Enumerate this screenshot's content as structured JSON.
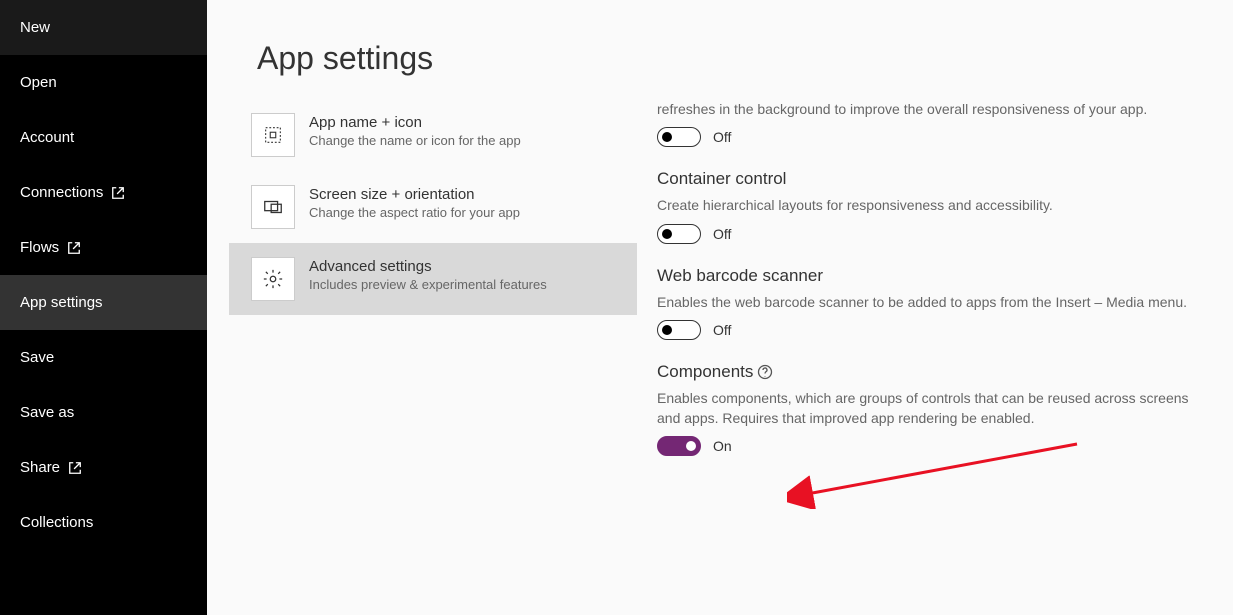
{
  "sidebar": {
    "items": [
      {
        "label": "New",
        "has_ext": false
      },
      {
        "label": "Open",
        "has_ext": false
      },
      {
        "label": "Account",
        "has_ext": false
      },
      {
        "label": "Connections",
        "has_ext": true
      },
      {
        "label": "Flows",
        "has_ext": true
      },
      {
        "label": "App settings",
        "has_ext": false,
        "selected": true
      },
      {
        "label": "Save",
        "has_ext": false
      },
      {
        "label": "Save as",
        "has_ext": false
      },
      {
        "label": "Share",
        "has_ext": true
      },
      {
        "label": "Collections",
        "has_ext": false
      }
    ]
  },
  "page": {
    "title": "App settings"
  },
  "settings_tabs": [
    {
      "icon": "app-icon",
      "title": "App name + icon",
      "desc": "Change the name or icon for the app"
    },
    {
      "icon": "screen-icon",
      "title": "Screen size + orientation",
      "desc": "Change the aspect ratio for your app"
    },
    {
      "icon": "gear-icon",
      "title": "Advanced settings",
      "desc": "Includes preview & experimental features",
      "selected": true
    }
  ],
  "detail": {
    "sections": [
      {
        "truncated_desc": "refreshes in the background to improve the overall responsiveness of your app.",
        "toggle": {
          "on": false,
          "label": "Off"
        }
      },
      {
        "heading": "Container control",
        "desc": "Create hierarchical layouts for responsiveness and accessibility.",
        "toggle": {
          "on": false,
          "label": "Off"
        }
      },
      {
        "heading": "Web barcode scanner",
        "desc": "Enables the web barcode scanner to be added to apps from the Insert – Media menu.",
        "toggle": {
          "on": false,
          "label": "Off"
        }
      },
      {
        "heading": "Components",
        "has_help": true,
        "desc": "Enables components, which are groups of controls that can be reused across screens and apps. Requires that improved app rendering be enabled.",
        "toggle": {
          "on": true,
          "label": "On"
        }
      }
    ]
  }
}
